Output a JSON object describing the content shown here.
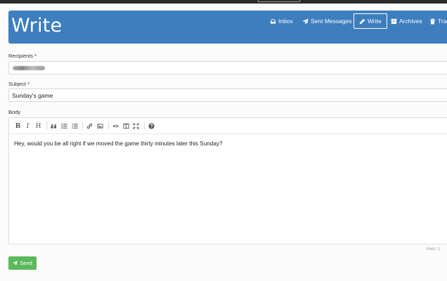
{
  "header": {
    "title": "Write",
    "nav": [
      {
        "label": "Inbox",
        "icon": "inbox-icon"
      },
      {
        "label": "Sent Messages",
        "icon": "paper-plane-icon"
      },
      {
        "label": "Write",
        "icon": "pencil-icon",
        "active": true
      },
      {
        "label": "Archives",
        "icon": "archive-icon"
      },
      {
        "label": "Trash",
        "icon": "trash-icon"
      }
    ]
  },
  "form": {
    "recipients_label": "Recipients *",
    "subject_label": "Subject *",
    "subject_value": "Sunday's game",
    "body_label": "Body",
    "body_text": "Hey, would you be all right if we moved the game thirty minutes later this Sunday?",
    "status": "lines: 1",
    "send_label": "Send"
  },
  "colors": {
    "header": "#3d7ebf",
    "send": "#5cb85c"
  }
}
